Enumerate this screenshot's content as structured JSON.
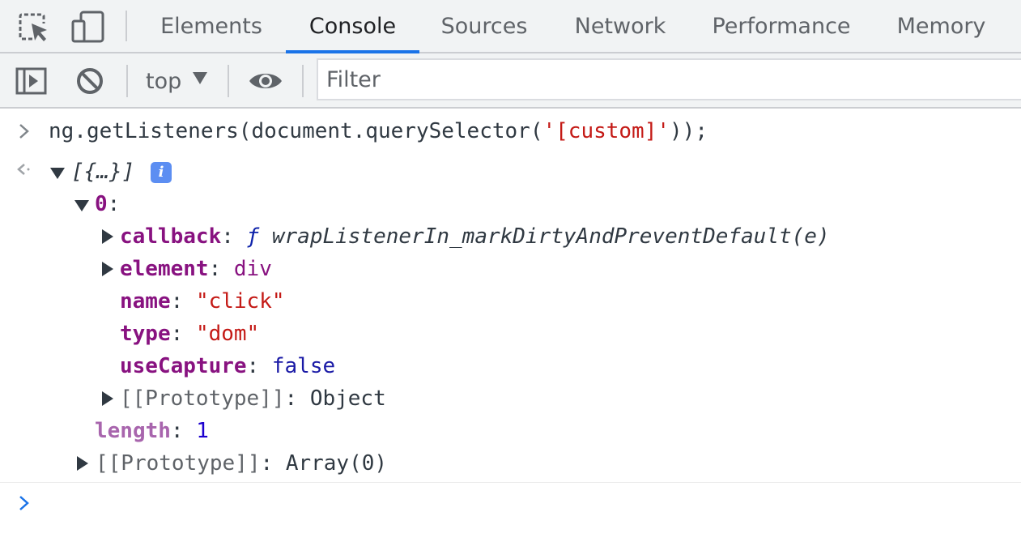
{
  "tabs": [
    {
      "label": "Elements",
      "active": false
    },
    {
      "label": "Console",
      "active": true
    },
    {
      "label": "Sources",
      "active": false
    },
    {
      "label": "Network",
      "active": false
    },
    {
      "label": "Performance",
      "active": false
    },
    {
      "label": "Memory",
      "active": false
    }
  ],
  "toolbar_icons": {
    "inspect": "inspect-element-icon",
    "device": "device-toolbar-icon",
    "sidebar": "show-sidebar-icon",
    "clear": "clear-console-icon",
    "eye": "live-expression-icon"
  },
  "toolbar": {
    "context": "top",
    "filter_placeholder": "Filter",
    "filter_value": ""
  },
  "console": {
    "input": {
      "before": "ng.getListeners(document.querySelector(",
      "string": "'[custom]'",
      "after": "));"
    },
    "result": {
      "summary": "[{…}]",
      "info_badge": "i",
      "index_key": "0",
      "callback_key": "callback",
      "callback_fn_symbol": "ƒ",
      "callback_value": "wrapListenerIn_markDirtyAndPreventDefault(e)",
      "element_key": "element",
      "element_value": "div",
      "name_key": "name",
      "name_value": "\"click\"",
      "type_key": "type",
      "type_value": "\"dom\"",
      "usecapture_key": "useCapture",
      "usecapture_value": "false",
      "proto_key": "[[Prototype]]",
      "proto_value": "Object",
      "length_key": "length",
      "length_value": "1",
      "array_proto_key": "[[Prototype]]",
      "array_proto_value": "Array(0)"
    },
    "colon": ":"
  },
  "colors": {
    "accent": "#1a73e8",
    "key": "#881280",
    "string": "#c41a16",
    "keyword": "#1a1aa6"
  }
}
